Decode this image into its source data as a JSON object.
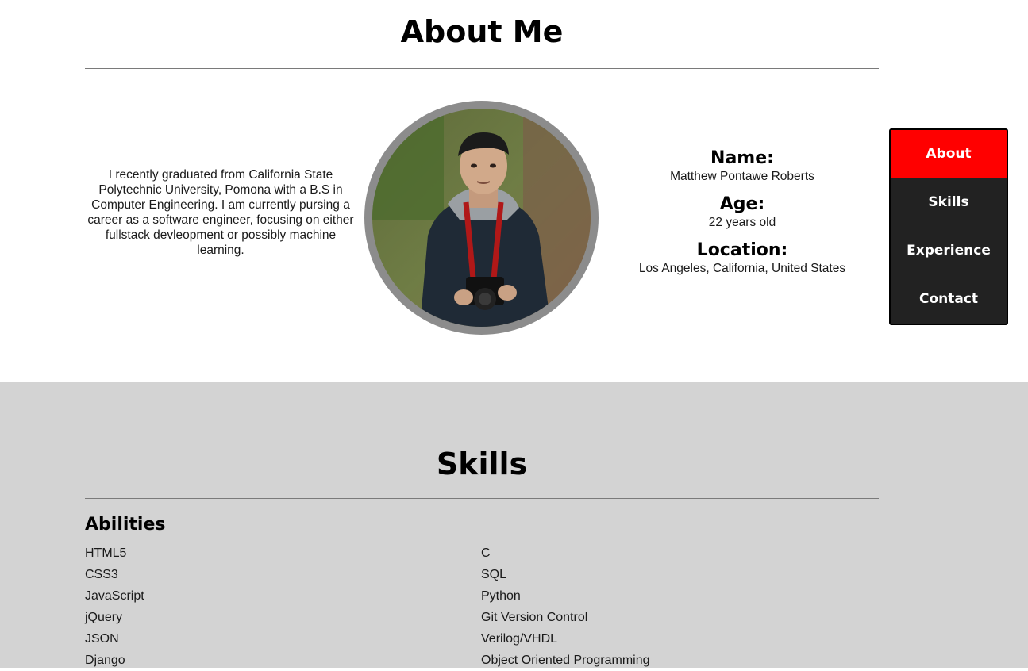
{
  "about": {
    "title": "About Me",
    "bio": "I recently graduated from California State Polytechnic University, Pomona with a B.S in Computer Engineering. I am currently pursing a career as a software engineer, focusing on either fullstack devleopment or possibly machine learning.",
    "details": [
      {
        "label": "Name:",
        "value": "Matthew Pontawe Roberts"
      },
      {
        "label": "Age:",
        "value": "22 years old"
      },
      {
        "label": "Location:",
        "value": "Los Angeles, California, United States"
      }
    ]
  },
  "nav": {
    "items": [
      {
        "label": "About",
        "active": true
      },
      {
        "label": "Skills",
        "active": false
      },
      {
        "label": "Experience",
        "active": false
      },
      {
        "label": "Contact",
        "active": false
      }
    ],
    "active_color": "#ff0000",
    "background_color": "#222222"
  },
  "skills": {
    "title": "Skills",
    "abilities_heading": "Abilities",
    "left_column": [
      "HTML5",
      "CSS3",
      "JavaScript",
      "jQuery",
      "JSON",
      "Django"
    ],
    "right_column": [
      "C",
      "SQL",
      "Python",
      "Git Version Control",
      "Verilog/VHDL",
      "Object Oriented Programming"
    ],
    "background_color": "#d3d3d3"
  }
}
